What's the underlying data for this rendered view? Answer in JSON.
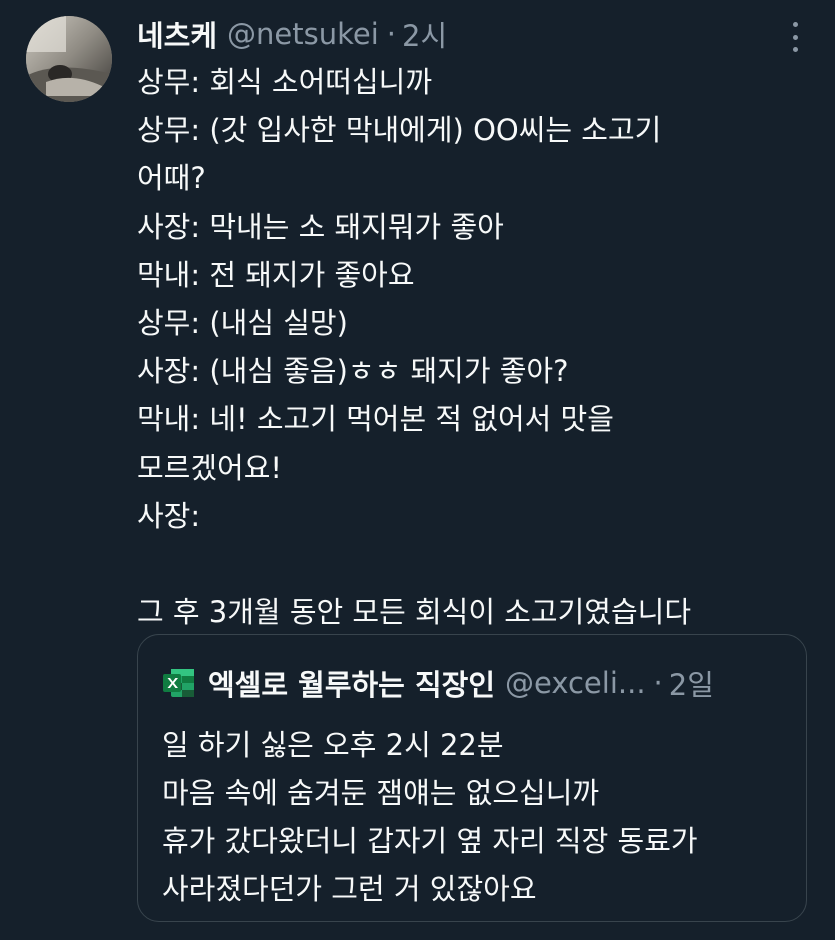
{
  "tweet": {
    "author": {
      "display_name": "네츠케",
      "handle": "@netsukei"
    },
    "separator": "·",
    "time": "2시",
    "more_icon": "more-horizontal-icon",
    "lines": [
      "상무: 회식 소어떠십니까",
      "상무: (갓 입사한 막내에게) OO씨는 소고기",
      "어때?",
      "사장: 막내는 소 돼지뭐가 좋아",
      "막내: 전 돼지가 좋아요",
      "상무: (내심 실망)",
      "사장: (내심 좋음)ㅎㅎ 돼지가 좋아?",
      "막내: 네! 소고기 먹어본 적 없어서 맛을",
      "모르겠어요!",
      "사장:",
      "",
      "그 후 3개월 동안 모든 회식이 소고기였습니다"
    ]
  },
  "quoted_tweet": {
    "author": {
      "display_name": "엑셀로 월루하는 직장인",
      "handle": "@exceli...",
      "avatar_icon": "excel-icon"
    },
    "separator": "·",
    "time": "2일",
    "lines": [
      "일 하기 싫은 오후 2시 22분",
      "마음 속에 숨겨둔 잼얘는 없으십니까",
      "휴가 갔다왔더니 갑자기 옆 자리 직장 동료가",
      "사라졌다던가 그런 거 있잖아요"
    ]
  },
  "colors": {
    "background": "#15202b",
    "primary_text": "#f7f9f9",
    "secondary_text": "#8b98a5",
    "border": "#38444d",
    "excel_green": "#1d6f42"
  }
}
